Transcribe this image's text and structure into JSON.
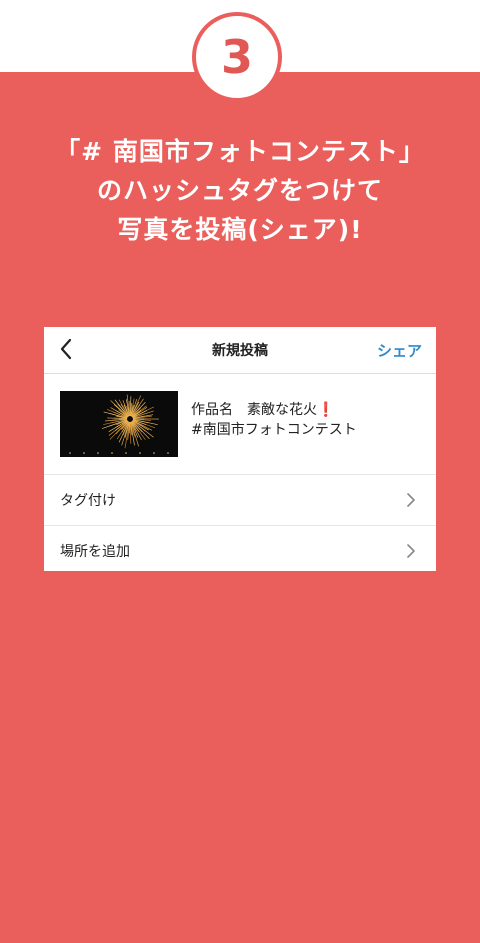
{
  "step": {
    "number": "3"
  },
  "headline": {
    "line1": "「# 南国市フォトコンテスト」",
    "line2": "のハッシュタグをつけて",
    "line3": "写真を投稿(シェア)!"
  },
  "post_screen": {
    "title": "新規投稿",
    "share_label": "シェア",
    "caption_line1": "作品名　素敵な花火",
    "caption_mark": "❗",
    "caption_line2": "#南国市フォトコンテスト",
    "menu_items": [
      {
        "label": "タグ付け"
      },
      {
        "label": "場所を追加"
      }
    ]
  },
  "icons": {
    "back": "chevron-left-icon",
    "row_arrow": "chevron-right-icon",
    "thumbnail": "fireworks-photo"
  },
  "colors": {
    "background_red": "#ea5f5b",
    "step_number": "#e05753",
    "share_blue": "#2e8bc9",
    "exclamation_red": "#e02020"
  }
}
